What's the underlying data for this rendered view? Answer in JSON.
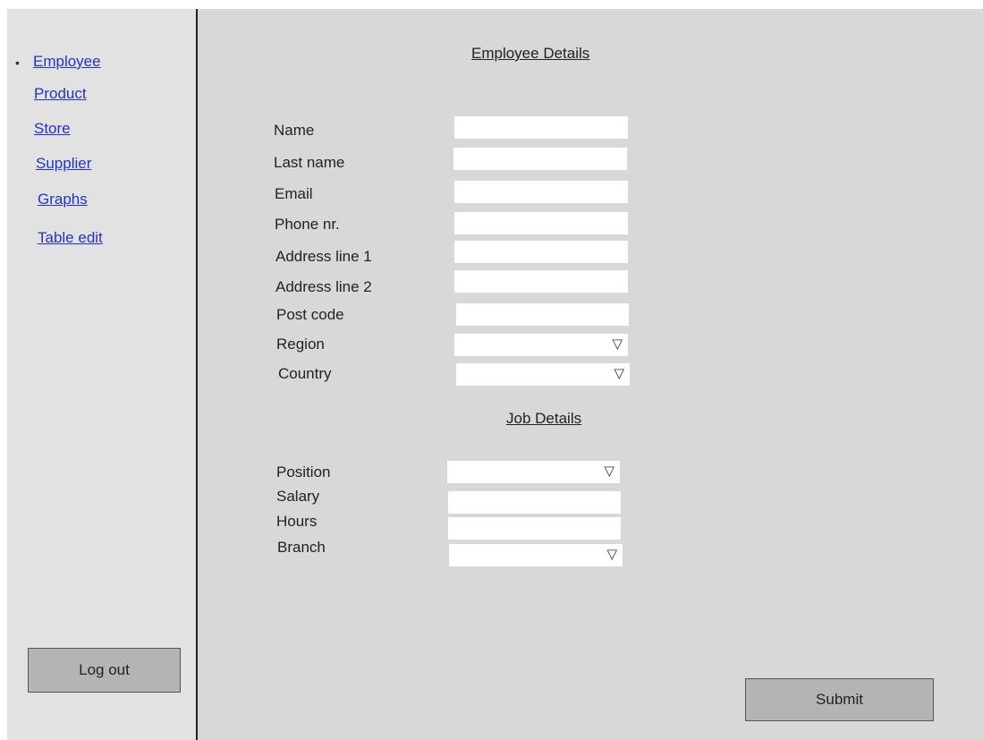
{
  "sidebar": {
    "items": [
      {
        "label": "Employee",
        "selected": true
      },
      {
        "label": "Product"
      },
      {
        "label": "Store"
      },
      {
        "label": "Supplier"
      },
      {
        "label": "Graphs"
      },
      {
        "label": "Table edit"
      }
    ],
    "bullet": "•",
    "logout_label": "Log out"
  },
  "employee_details": {
    "heading": "Employee Details",
    "fields": [
      {
        "label": "Name",
        "type": "text",
        "value": ""
      },
      {
        "label": "Last name",
        "type": "text",
        "value": ""
      },
      {
        "label": "Email",
        "type": "text",
        "value": ""
      },
      {
        "label": "Phone nr.",
        "type": "text",
        "value": ""
      },
      {
        "label": "Address line 1",
        "type": "text",
        "value": ""
      },
      {
        "label": "Address line 2",
        "type": "text",
        "value": ""
      },
      {
        "label": "Post code",
        "type": "text",
        "value": ""
      },
      {
        "label": "Region",
        "type": "select",
        "value": ""
      },
      {
        "label": "Country",
        "type": "select",
        "value": ""
      }
    ]
  },
  "job_details": {
    "heading": "Job Details",
    "fields": [
      {
        "label": "Position",
        "type": "select",
        "value": ""
      },
      {
        "label": "Salary",
        "type": "text",
        "value": ""
      },
      {
        "label": "Hours",
        "type": "text",
        "value": ""
      },
      {
        "label": "Branch",
        "type": "select",
        "value": ""
      }
    ]
  },
  "dropdown_icon": "▽",
  "submit_label": "Submit",
  "colors": {
    "link": "#2233cc",
    "panel_background": "#d8d8d8",
    "sidebar_background": "#e2e2e2",
    "button_background": "#b4b4b4"
  }
}
